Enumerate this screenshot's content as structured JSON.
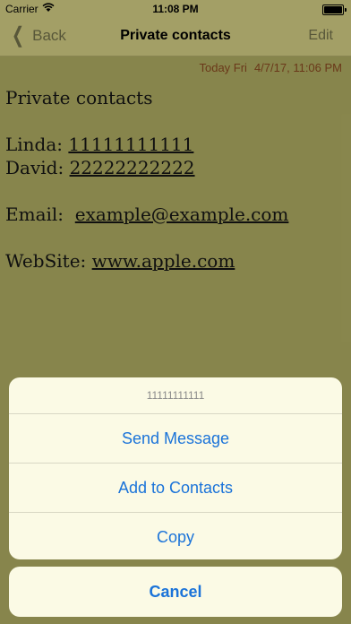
{
  "status_bar": {
    "carrier": "Carrier",
    "time": "11:08 PM"
  },
  "nav": {
    "back": "Back",
    "title": "Private contacts",
    "edit": "Edit"
  },
  "note": {
    "date_label": "Today Fri",
    "date_value": "4/7/17, 11:06 PM",
    "heading": "Private contacts",
    "contacts": [
      {
        "name": "Linda:",
        "phone": "11111111111"
      },
      {
        "name": "David:",
        "phone": "22222222222"
      }
    ],
    "email_label": "Email:",
    "email": "example@example.com",
    "website_label": "WebSite:",
    "website": "www.apple.com"
  },
  "action_sheet": {
    "title": "11111111111",
    "actions": [
      "Send Message",
      "Add to Contacts",
      "Copy"
    ],
    "cancel": "Cancel"
  },
  "colors": {
    "background": "#8c8a4f",
    "bar": "#a9a56a",
    "sheet": "#fbfae5",
    "action_text": "#1a73d9"
  }
}
